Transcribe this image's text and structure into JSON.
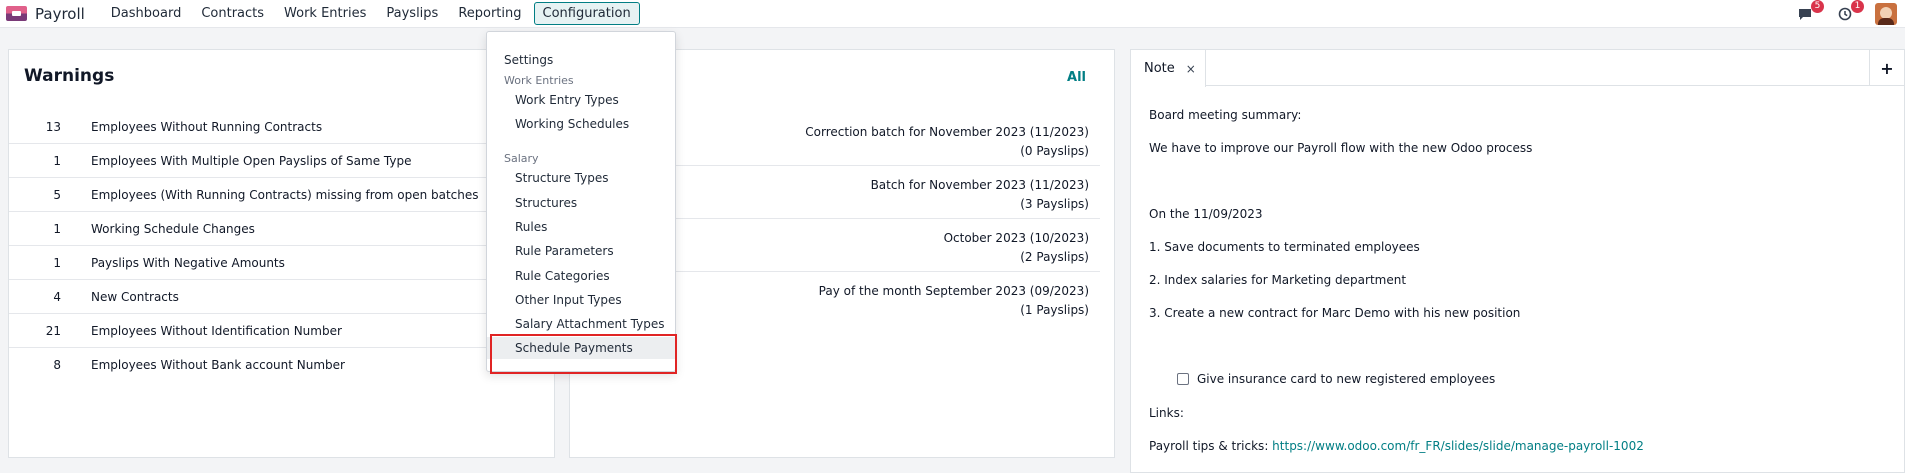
{
  "app": {
    "name": "Payroll"
  },
  "menu": {
    "items": [
      "Dashboard",
      "Contracts",
      "Work Entries",
      "Payslips",
      "Reporting",
      "Configuration"
    ]
  },
  "systray": {
    "messages_count": "5",
    "activities_count": "1",
    "messages_icon": "chat-bubble-icon",
    "activities_icon": "clock-icon"
  },
  "warnings": {
    "title": "Warnings",
    "rows": [
      {
        "count": "13",
        "label": "Employees Without Running Contracts"
      },
      {
        "count": "1",
        "label": "Employees With Multiple Open Payslips of Same Type"
      },
      {
        "count": "5",
        "label": "Employees (With Running Contracts) missing from open batches"
      },
      {
        "count": "1",
        "label": "Working Schedule Changes"
      },
      {
        "count": "1",
        "label": "Payslips With Negative Amounts"
      },
      {
        "count": "4",
        "label": "New Contracts"
      },
      {
        "count": "21",
        "label": "Employees Without Identification Number"
      },
      {
        "count": "8",
        "label": "Employees Without Bank account Number"
      }
    ]
  },
  "batches": {
    "all_label": "All",
    "rows": [
      {
        "name": "Correction batch for November 2023 (11/2023)",
        "count": "(0 Payslips)"
      },
      {
        "name": "Batch for November 2023 (11/2023)",
        "count": "(3 Payslips)"
      },
      {
        "name": "October 2023 (10/2023)",
        "count": "(2 Payslips)"
      },
      {
        "name": "Pay of the month September 2023 (09/2023)",
        "count": "(1 Payslips)"
      }
    ]
  },
  "note": {
    "tab_label": "Note",
    "close_symbol": "×",
    "add_symbol": "+",
    "lines": {
      "summary": "Board meeting summary:",
      "improve": "We have to improve our Payroll flow with the new Odoo process",
      "date": "On the 11/09/2023",
      "item1": "1. Save documents to terminated employees",
      "item2": "2. Index salaries for Marketing department",
      "item3": "3. Create a new contract for Marc Demo with his new position",
      "checkbox_label": "Give insurance card to new registered employees",
      "links": "Links:",
      "tips_prefix": "Payroll tips & tricks: ",
      "tips_url": "https://www.odoo.com/fr_FR/slides/slide/manage-payroll-1002"
    }
  },
  "dropdown": {
    "settings": "Settings",
    "section_work_entries": "Work Entries",
    "work_entry_types": "Work Entry Types",
    "working_schedules": "Working Schedules",
    "section_salary": "Salary",
    "structure_types": "Structure Types",
    "structures": "Structures",
    "rules": "Rules",
    "rule_parameters": "Rule Parameters",
    "rule_categories": "Rule Categories",
    "other_input_types": "Other Input Types",
    "salary_attachment_types": "Salary Attachment Types",
    "schedule_payments": "Schedule Payments"
  },
  "colors": {
    "accent": "#017e84",
    "highlight": "#e02424",
    "badge": "#d9344b"
  }
}
